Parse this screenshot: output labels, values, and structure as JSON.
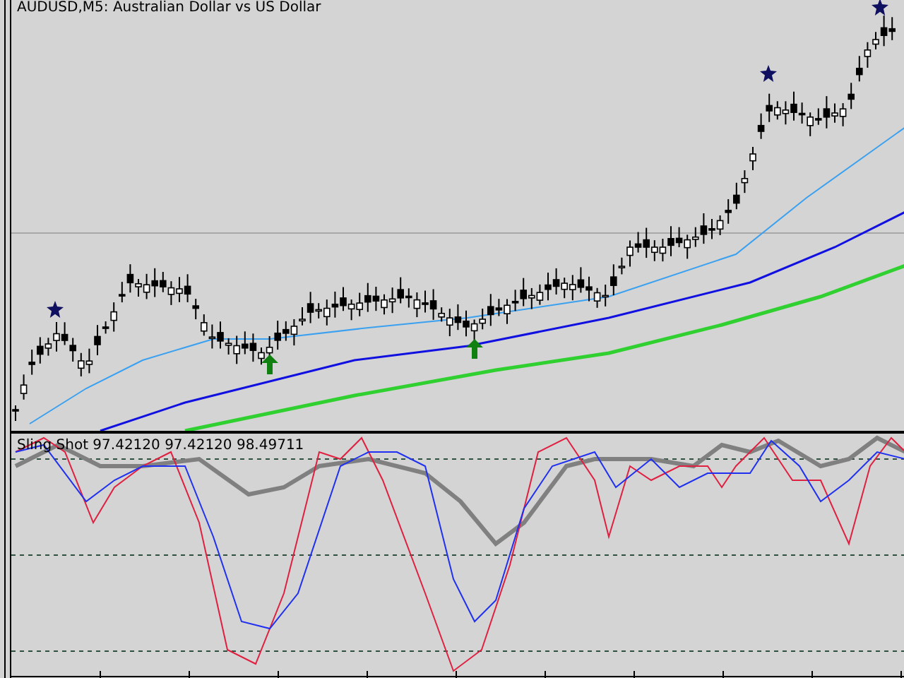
{
  "window": {
    "title": "AUDUSD,M5: Australian Dollar vs US Dollar"
  },
  "indicator": {
    "label": "Sling Shot 97.42120 97.42120 98.49711"
  }
}
